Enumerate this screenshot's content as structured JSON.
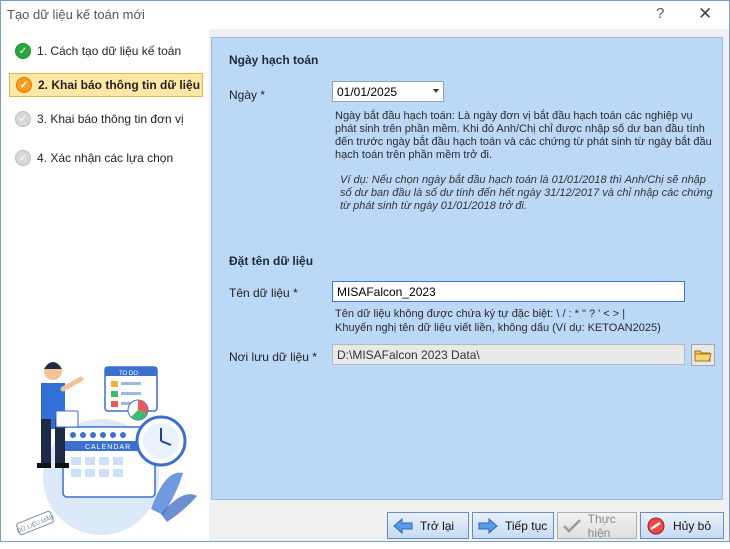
{
  "window": {
    "title": "Tạo dữ liệu kế toán mới",
    "help_glyph": "?",
    "close_glyph": "✕"
  },
  "steps": [
    {
      "label": "1. Cách tạo dữ liệu kế toán",
      "state": "done"
    },
    {
      "label": "2. Khai báo thông tin dữ liệu",
      "state": "current"
    },
    {
      "label": "3. Khai báo thông tin đơn vị",
      "state": "todo"
    },
    {
      "label": "4. Xác nhận các lựa chọn",
      "state": "todo"
    }
  ],
  "illustration": {
    "board_title": "TO DO",
    "calendar_word": "CALENDAR",
    "watermark": "DỮ LIỆU MẪU"
  },
  "accounting_date": {
    "section_title": "Ngày hạch toán",
    "date_label": "Ngày *",
    "date_value": "01/01/2025",
    "description": "Ngày bắt đầu hạch toán: Là ngày đơn vị bắt đầu hạch toán các nghiệp vụ phát sinh trên phần mềm. Khi đó Anh/Chị chỉ được nhập số dư ban đầu tính đến trước ngày bắt đầu hạch toán và các chứng từ phát sinh từ ngày bắt đầu hạch toán trên phần mềm trở đi.",
    "example": "Ví dụ: Nếu chọn ngày bắt đầu hạch toán là 01/01/2018 thì Anh/Chị sẽ nhập số dư ban đầu là số dư tính đến hết ngày 31/12/2017 và chỉ nhập các chứng từ phát sinh từ ngày 01/01/2018 trở đi."
  },
  "data_name": {
    "section_title": "Đặt tên dữ liệu",
    "name_label": "Tên dữ liệu *",
    "name_value": "MISAFalcon_2023",
    "hint_line1": "Tên dữ liệu không được chứa ký tự đặc biệt: \\ / : * \" ? ' < > |",
    "hint_line2": "Khuyến nghị tên dữ liệu viết liền, không dấu (Ví dụ: KETOAN2025)",
    "location_label": "Nơi lưu dữ liệu *",
    "location_value": "D:\\MISAFalcon 2023 Data\\"
  },
  "buttons": {
    "back": "Trở lại",
    "next": "Tiếp tục",
    "finish": "Thực hiện",
    "cancel": "Hủy bỏ"
  },
  "colors": {
    "panel_bg": "#bbd9f7",
    "active_step_bg": "#ffe8a6",
    "done_green": "#2aa640",
    "current_orange": "#ff9b1f"
  }
}
